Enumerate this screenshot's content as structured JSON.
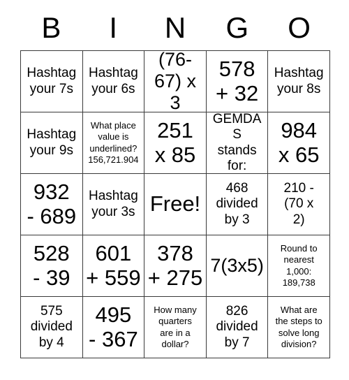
{
  "card": {
    "title": "BINGO",
    "header_letters": [
      "B",
      "I",
      "N",
      "G",
      "O"
    ],
    "free_space_label": "Free!",
    "rows": [
      [
        {
          "text": "Hashtag\nyour 7s",
          "size": "md"
        },
        {
          "text": "Hashtag\nyour 6s",
          "size": "md"
        },
        {
          "text": "(76-\n67) x 3",
          "size": "lg"
        },
        {
          "text": "578\n+ 32",
          "size": "xl"
        },
        {
          "text": "Hashtag\nyour 8s",
          "size": "md"
        }
      ],
      [
        {
          "text": "Hashtag\nyour 9s",
          "size": "md"
        },
        {
          "text": "What place\nvalue is\nunderlined?\n156,721.904",
          "size": "xs"
        },
        {
          "text": "251\nx 85",
          "size": "xl"
        },
        {
          "text": "GEMDAS\nstands\nfor:",
          "size": "md"
        },
        {
          "text": "984\nx 65",
          "size": "xl"
        }
      ],
      [
        {
          "text": "932\n- 689",
          "size": "xl"
        },
        {
          "text": "Hashtag\nyour 3s",
          "size": "md"
        },
        {
          "text": "Free!",
          "size": "xl"
        },
        {
          "text": "468\ndivided\nby 3",
          "size": "md"
        },
        {
          "text": "210 -\n(70 x\n2)",
          "size": "md"
        }
      ],
      [
        {
          "text": "528\n- 39",
          "size": "xl"
        },
        {
          "text": "601\n+ 559",
          "size": "xl"
        },
        {
          "text": "378\n+ 275",
          "size": "xl"
        },
        {
          "text": "7(3x5)",
          "size": "lg"
        },
        {
          "text": "Round to\nnearest\n1,000:\n189,738",
          "size": "xs"
        }
      ],
      [
        {
          "text": "575\ndivided\nby 4",
          "size": "md"
        },
        {
          "text": "495\n- 367",
          "size": "xl"
        },
        {
          "text": "How many\nquarters\nare in a\ndollar?",
          "size": "xs"
        },
        {
          "text": "826\ndivided\nby 7",
          "size": "md"
        },
        {
          "text": "What are\nthe steps to\nsolve long\ndivision?",
          "size": "xs"
        }
      ]
    ]
  },
  "colors": {
    "background": "#ffffff",
    "text": "#000000",
    "grid_line": "#3a3a3a"
  }
}
